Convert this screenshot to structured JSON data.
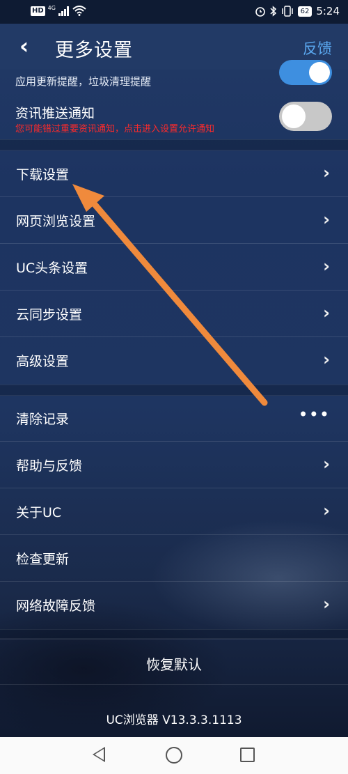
{
  "status_bar": {
    "hd": "HD",
    "network": "4G",
    "battery": "62",
    "time": "5:24"
  },
  "header": {
    "back_icon": "chevron-left-icon",
    "title": "更多设置",
    "feedback": "反馈"
  },
  "notifications": {
    "update_reminder_desc": "应用更新提醒，垃圾清理提醒",
    "update_reminder_on": true,
    "news_push_title": "资讯推送通知",
    "news_push_warning": "您可能错过重要资讯通知，点击进入设置允许通知",
    "news_push_on": false
  },
  "settings_group": [
    {
      "label": "下载设置"
    },
    {
      "label": "网页浏览设置"
    },
    {
      "label": "UC头条设置"
    },
    {
      "label": "云同步设置"
    },
    {
      "label": "高级设置"
    }
  ],
  "misc_group": [
    {
      "label": "清除记录",
      "trailing": "•••"
    },
    {
      "label": "帮助与反馈",
      "trailing": "›"
    },
    {
      "label": "关于UC",
      "trailing": "›"
    },
    {
      "label": "检查更新",
      "trailing": ""
    },
    {
      "label": "网络故障反馈",
      "trailing": "›"
    }
  ],
  "restore_defaults": "恢复默认",
  "version": "UC浏览器 V13.3.3.1113",
  "colors": {
    "accent": "#5aa8f0",
    "warning": "#ff2a2a",
    "annotation_arrow": "#f08a3c"
  }
}
